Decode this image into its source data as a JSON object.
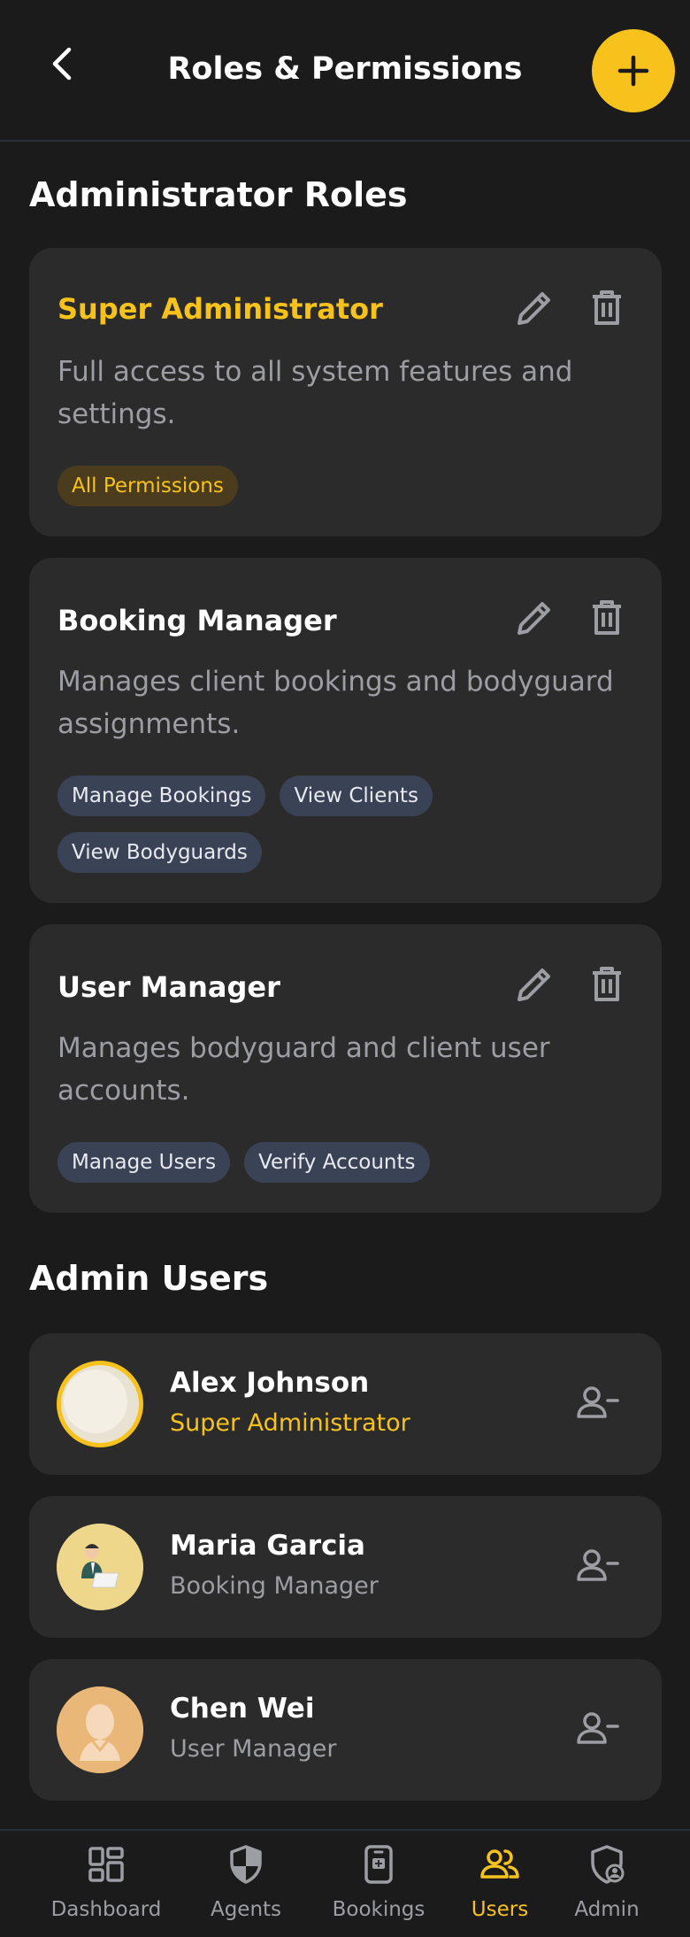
{
  "header": {
    "title": "Roles & Permissions",
    "back_icon": "chevron-left-icon",
    "add_icon": "plus-icon"
  },
  "roles_section": {
    "title": "Administrator Roles",
    "roles": [
      {
        "title": "Super Administrator",
        "description": "Full access to all system features and settings.",
        "permissions": [
          "All Permissions"
        ],
        "highlight": true
      },
      {
        "title": "Booking Manager",
        "description": "Manages client bookings and bodyguard assignments.",
        "permissions": [
          "Manage Bookings",
          "View Clients",
          "View Bodyguards"
        ],
        "highlight": false
      },
      {
        "title": "User Manager",
        "description": "Manages bodyguard and client user accounts.",
        "permissions": [
          "Manage Users",
          "Verify Accounts"
        ],
        "highlight": false
      }
    ]
  },
  "users_section": {
    "title": "Admin Users",
    "users": [
      {
        "name": "Alex Johnson",
        "role": "Super Administrator",
        "highlight": true
      },
      {
        "name": "Maria Garcia",
        "role": "Booking Manager",
        "highlight": false
      },
      {
        "name": "Chen Wei",
        "role": "User Manager",
        "highlight": false
      }
    ]
  },
  "nav": {
    "items": [
      {
        "label": "Dashboard",
        "icon": "dashboard-icon",
        "active": false
      },
      {
        "label": "Agents",
        "icon": "shield-icon",
        "active": false
      },
      {
        "label": "Bookings",
        "icon": "booking-icon",
        "active": false
      },
      {
        "label": "Users",
        "icon": "users-icon",
        "active": true
      },
      {
        "label": "Admin",
        "icon": "admin-shield-icon",
        "active": false
      }
    ]
  },
  "colors": {
    "background": "#1b1b1c",
    "card": "#2b2b2c",
    "accent": "#f8c21c",
    "muted_text": "#9d9ea3",
    "chip": "#3a4356"
  }
}
